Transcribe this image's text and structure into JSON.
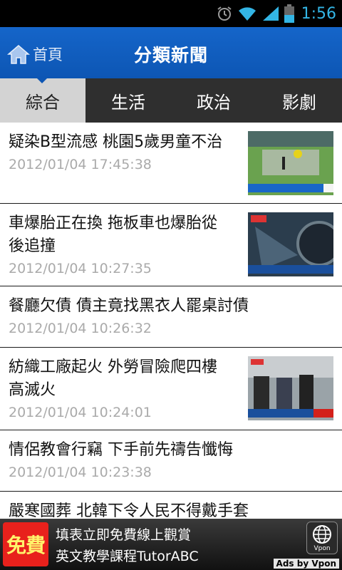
{
  "status_bar": {
    "time": "1:56"
  },
  "header": {
    "home_label": "首頁",
    "title": "分類新聞"
  },
  "tabs": [
    {
      "label": "綜合",
      "active": true
    },
    {
      "label": "生活",
      "active": false
    },
    {
      "label": "政治",
      "active": false
    },
    {
      "label": "影劇",
      "active": false
    }
  ],
  "news": [
    {
      "headline_lines": [
        "疑染B型流感 桃園5歲男童不治"
      ],
      "date": "2012/01/04 17:45:38",
      "has_thumb": true
    },
    {
      "headline_lines": [
        "車爆胎正在換 拖板車也爆胎從",
        "後追撞"
      ],
      "date": "2012/01/04 10:27:35",
      "has_thumb": true
    },
    {
      "headline_lines": [
        "餐廳欠債 債主竟找黑衣人罷桌討債"
      ],
      "date": "2012/01/04 10:26:32",
      "has_thumb": false
    },
    {
      "headline_lines": [
        "紡織工廠起火 外勞冒險爬四樓",
        "高滅火"
      ],
      "date": "2012/01/04 10:24:01",
      "has_thumb": true
    },
    {
      "headline_lines": [
        "情侶教會行竊 下手前先禱告懺悔"
      ],
      "date": "2012/01/04 10:23:38",
      "has_thumb": false
    },
    {
      "headline_lines": [
        "嚴寒國葬 北韓下令人民不得戴手套"
      ],
      "date": "",
      "has_thumb": false
    }
  ],
  "ad": {
    "badge": "免費",
    "line1": "填表立即免費線上觀賞",
    "line2": "英文教學課程TutorABC",
    "logo_text": "Vpon",
    "ads_by": "Ads by Vpon"
  }
}
